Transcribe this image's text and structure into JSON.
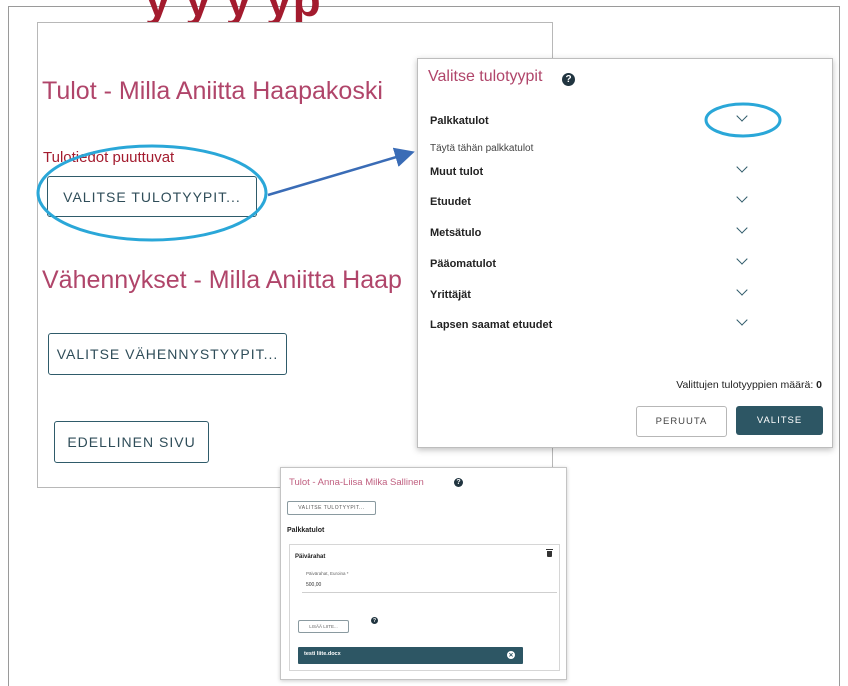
{
  "background_page": {
    "top_heading_fragment": "y y y yp",
    "income_title": "Tulot - Milla Aniitta Haapakoski",
    "income_missing": "Tulotiedot puuttuvat",
    "select_income_button": "VALITSE TULOTYYPIT...",
    "deductions_title": "Vähennykset - Milla Aniitta Haap",
    "select_deductions_button": "VALITSE VÄHENNYSTYYPIT...",
    "previous_page_button": "EDELLINEN SIVU"
  },
  "modal": {
    "title": "Valitse tulotyypit",
    "help_icon": "?",
    "categories": [
      {
        "label": "Palkkatulot",
        "hint": "Täytä tähän palkkatulot"
      },
      {
        "label": "Muut tulot"
      },
      {
        "label": "Etuudet"
      },
      {
        "label": "Metsätulo"
      },
      {
        "label": "Pääomatulot"
      },
      {
        "label": "Yrittäjät"
      },
      {
        "label": "Lapsen saamat etuudet"
      }
    ],
    "count_label": "Valittujen tulotyyppien määrä:",
    "count_value": "0",
    "cancel_button": "PERUUTA",
    "select_button": "VALITSE"
  },
  "inset": {
    "title": "Tulot - Anna-Liisa Milka Sallinen",
    "select_button": "VALITSE TULOTYYPIT...",
    "category": "Palkkatulot",
    "card_title": "Päivärahat",
    "field_label": "Päivärahat, Euroina *",
    "field_value": "500,00",
    "add_attachment_button": "LISÄÄ LIITE...",
    "file_name": "testi liite.docx",
    "file_close": "✕"
  },
  "annotation_colors": {
    "highlight_circle": "#2aa7d8",
    "arrow": "#3a6cb6"
  }
}
